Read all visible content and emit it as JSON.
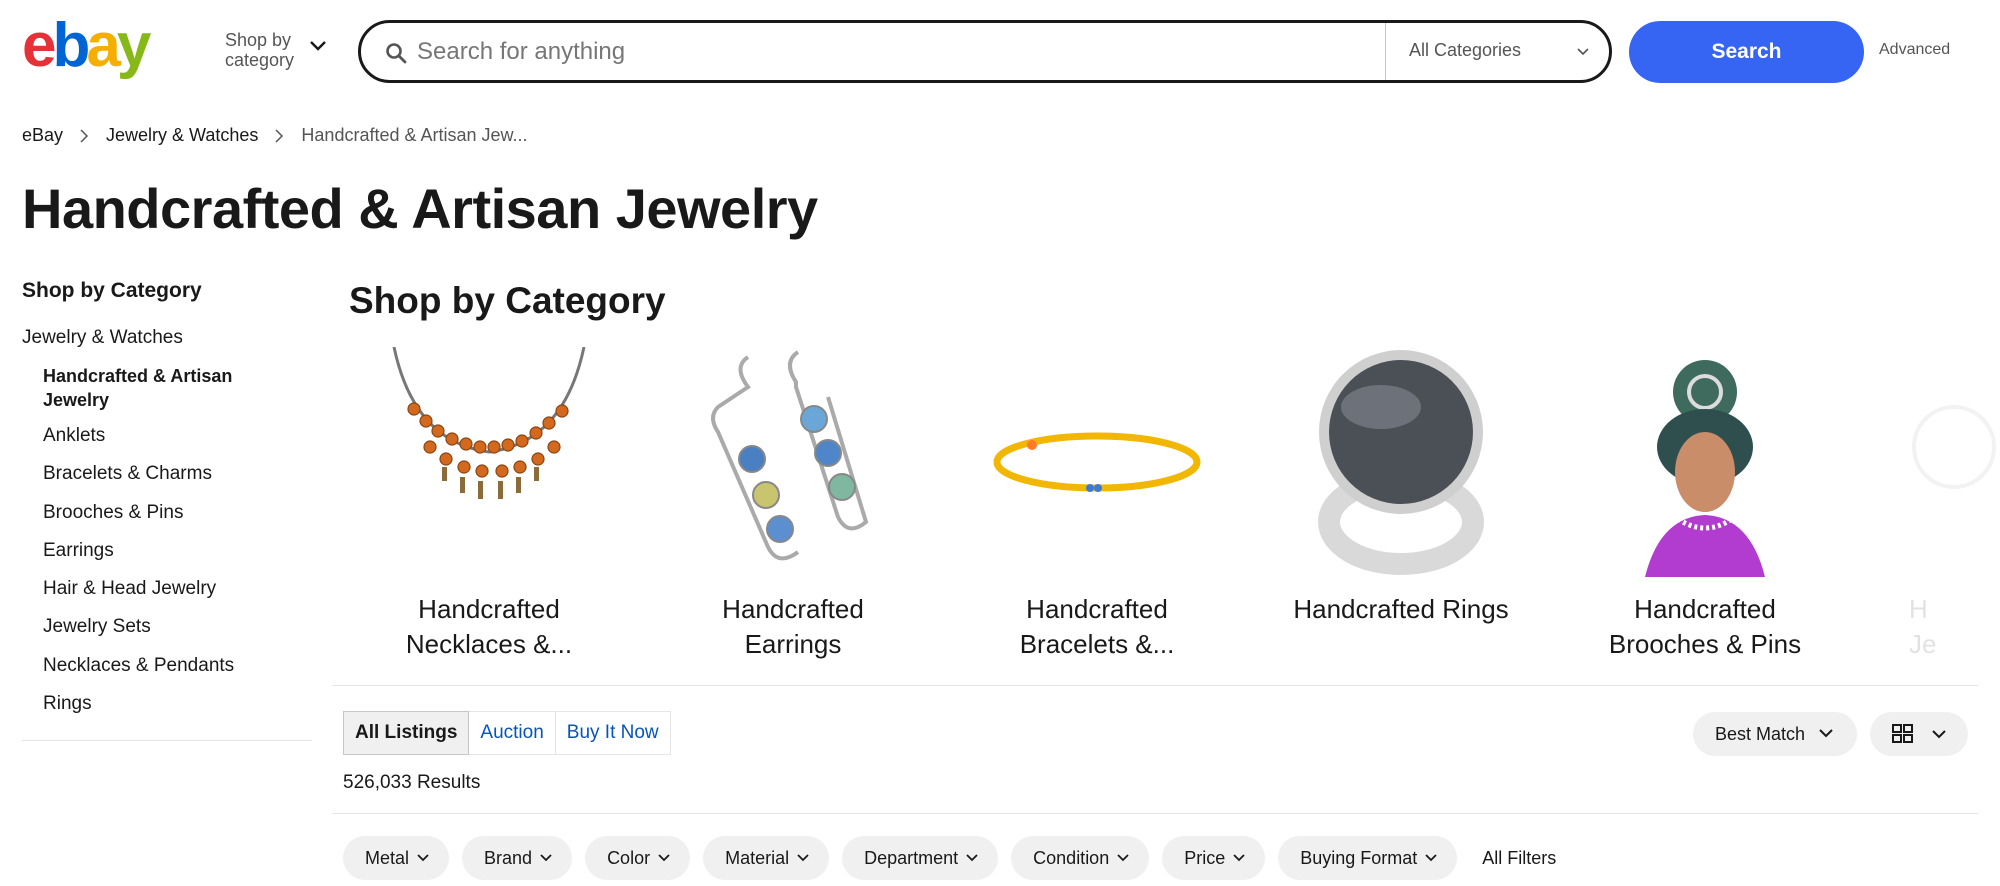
{
  "header": {
    "logo_text": "ebay",
    "shop_by_category": [
      "Shop by",
      "category"
    ],
    "search_placeholder": "Search for anything",
    "category_select": "All Categories",
    "search_button": "Search",
    "advanced": "Advanced"
  },
  "breadcrumb": [
    "eBay",
    "Jewelry & Watches",
    "Handcrafted & Artisan Jew..."
  ],
  "page_title": "Handcrafted & Artisan Jewelry",
  "sidebar": {
    "heading": "Shop by Category",
    "parent": "Jewelry & Watches",
    "current": "Handcrafted & Artisan Jewelry",
    "items": [
      "Anklets",
      "Bracelets & Charms",
      "Brooches & Pins",
      "Earrings",
      "Hair & Head Jewelry",
      "Jewelry Sets",
      "Necklaces & Pendants",
      "Rings"
    ]
  },
  "categories": {
    "heading": "Shop by Category",
    "tiles": [
      {
        "line1": "Handcrafted",
        "line2": "Necklaces &..."
      },
      {
        "line1": "Handcrafted",
        "line2": "Earrings"
      },
      {
        "line1": "Handcrafted",
        "line2": "Bracelets &..."
      },
      {
        "line1": "Handcrafted Rings",
        "line2": ""
      },
      {
        "line1": "Handcrafted",
        "line2": "Brooches & Pins"
      },
      {
        "line1": "H",
        "line2": "Je"
      }
    ]
  },
  "listing_tabs": [
    "All Listings",
    "Auction",
    "Buy It Now"
  ],
  "results_count": "526,033 Results",
  "sort": "Best Match",
  "filters": [
    "Metal",
    "Brand",
    "Color",
    "Material",
    "Department",
    "Condition",
    "Price",
    "Buying Format"
  ],
  "all_filters": "All Filters",
  "colors": {
    "search_blue": "#3665f3",
    "link_blue": "#0654ba",
    "ebay_red": "#e53238",
    "ebay_blue": "#0064d2",
    "ebay_yellow": "#f5af02",
    "ebay_green": "#86b817"
  }
}
